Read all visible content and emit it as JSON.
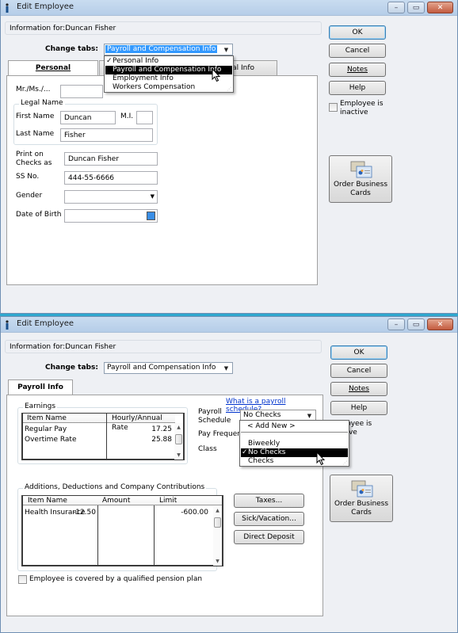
{
  "window1": {
    "title": "Edit Employee",
    "info_label": "Information for:",
    "employee_name": "Duncan Fisher",
    "change_tabs_label": "Change tabs:",
    "change_tabs_value": "Payroll and Compensation Info",
    "change_tabs_options": [
      {
        "label": "Personal Info",
        "checked": true,
        "highlighted": false
      },
      {
        "label": "Payroll and Compensation Info",
        "checked": false,
        "highlighted": true
      },
      {
        "label": "Employment Info",
        "checked": false,
        "highlighted": false
      },
      {
        "label": "Workers Compensation",
        "checked": false,
        "highlighted": false
      }
    ],
    "tabs": [
      {
        "label": "Personal",
        "active": true
      },
      {
        "label": "Additional Info",
        "active": false
      }
    ],
    "visible_tab2_fragment": "nal Info",
    "buttons": {
      "ok": "OK",
      "cancel": "Cancel",
      "notes": "Notes",
      "help": "Help"
    },
    "inactive_checkbox": {
      "label_line1": "Employee is",
      "label_line2": "inactive",
      "checked": false
    },
    "business_cards": {
      "line1": "Order Business",
      "line2": "Cards"
    },
    "personal": {
      "salutation_label": "Mr./Ms./...",
      "salutation_value": "",
      "legal_name_legend": "Legal Name",
      "first_name_label": "First Name",
      "first_name_value": "Duncan",
      "mi_label": "M.I.",
      "mi_value": "",
      "last_name_label": "Last Name",
      "last_name_value": "Fisher",
      "print_on_checks_label_line1": "Print on",
      "print_on_checks_label_line2": "Checks as",
      "print_on_checks_value": "Duncan Fisher",
      "ssn_label": "SS No.",
      "ssn_value": "444-55-6666",
      "gender_label": "Gender",
      "gender_value": "",
      "dob_label": "Date of Birth",
      "dob_value": ""
    }
  },
  "window2": {
    "title": "Edit Employee",
    "info_label": "Information for:",
    "employee_name": "Duncan Fisher",
    "change_tabs_label": "Change tabs:",
    "change_tabs_value": "Payroll and Compensation Info",
    "tab": "Payroll Info",
    "buttons": {
      "ok": "OK",
      "cancel": "Cancel",
      "notes": "Notes",
      "help": "Help"
    },
    "inactive_fragment_line1": "ployee is",
    "inactive_fragment_line2": "ctive",
    "business_cards": {
      "line1": "Order Business",
      "line2": "Cards"
    },
    "payroll_schedule_link": "What is a payroll schedule?",
    "earnings": {
      "legend": "Earnings",
      "columns": [
        "Item Name",
        "Hourly/Annual Rate"
      ],
      "rows": [
        {
          "item": "Regular Pay",
          "rate": "17.25"
        },
        {
          "item": "Overtime Rate",
          "rate": "25.88"
        }
      ]
    },
    "payroll_schedule_label_line1": "Payroll",
    "payroll_schedule_label_line2": "Schedule",
    "payroll_schedule_value": "No Checks",
    "pay_frequency_label": "Pay Frequen",
    "class_label": "Class",
    "schedule_options": [
      {
        "label": "< Add New >",
        "checked": false,
        "highlighted": false
      },
      {
        "label": "Biweekly",
        "checked": false,
        "highlighted": false
      },
      {
        "label": "No Checks",
        "checked": true,
        "highlighted": true
      },
      {
        "label": "Checks",
        "checked": false,
        "highlighted": false
      }
    ],
    "deductions": {
      "legend": "Additions, Deductions and Company Contributions",
      "columns": [
        "Item Name",
        "Amount",
        "Limit"
      ],
      "rows": [
        {
          "item": "Health Insurance",
          "amount": "-12.50",
          "limit": "-600.00"
        }
      ]
    },
    "side_buttons": {
      "taxes": "Taxes...",
      "sick_vacation": "Sick/Vacation...",
      "direct_deposit": "Direct Deposit"
    },
    "pension_checkbox": {
      "label": "Employee is covered by a qualified pension plan",
      "checked": false
    }
  }
}
